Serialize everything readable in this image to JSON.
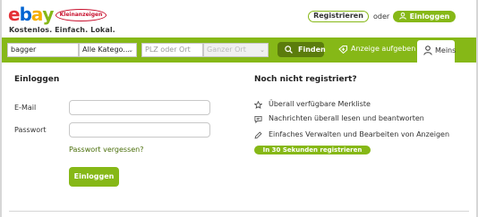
{
  "logo": {
    "letters": [
      "e",
      "b",
      "a",
      "y"
    ],
    "letter_colors": [
      "#e53238",
      "#0064d2",
      "#f5af02",
      "#86b817"
    ],
    "badge": "Kleinanzeigen",
    "slogan": "Kostenlos. Einfach. Lokal."
  },
  "header": {
    "register_label": "Registrieren",
    "or_label": "oder",
    "login_label": "Einloggen",
    "login_icon": "user-icon"
  },
  "search": {
    "query_value": "bagger",
    "category_value": "Alle Katego...",
    "location_placeholder": "PLZ oder Ort",
    "radius_placeholder": "Ganzer Ort",
    "search_label": "Finden",
    "post_ad_label": "Anzeige aufgeben",
    "my_account_label": "Meins"
  },
  "login": {
    "title": "Einloggen",
    "email_label": "E-Mail",
    "password_label": "Passwort",
    "forgot_label": "Passwort vergessen?",
    "submit_label": "Einloggen"
  },
  "register": {
    "title": "Noch nicht registriert?",
    "benefits": [
      {
        "icon": "star-icon",
        "text": "Überall verfügbare Merkliste"
      },
      {
        "icon": "message-icon",
        "text": "Nachrichten überall lesen und beantworten"
      },
      {
        "icon": "pencil-icon",
        "text": "Einfaches Verwalten und Bearbeiten von Anzeigen"
      }
    ],
    "cta_label": "In 30 Sekunden registrieren"
  },
  "colors": {
    "accent": "#86b817",
    "accent_dark": "#5b7c0c",
    "brand_red": "#c8102e"
  }
}
